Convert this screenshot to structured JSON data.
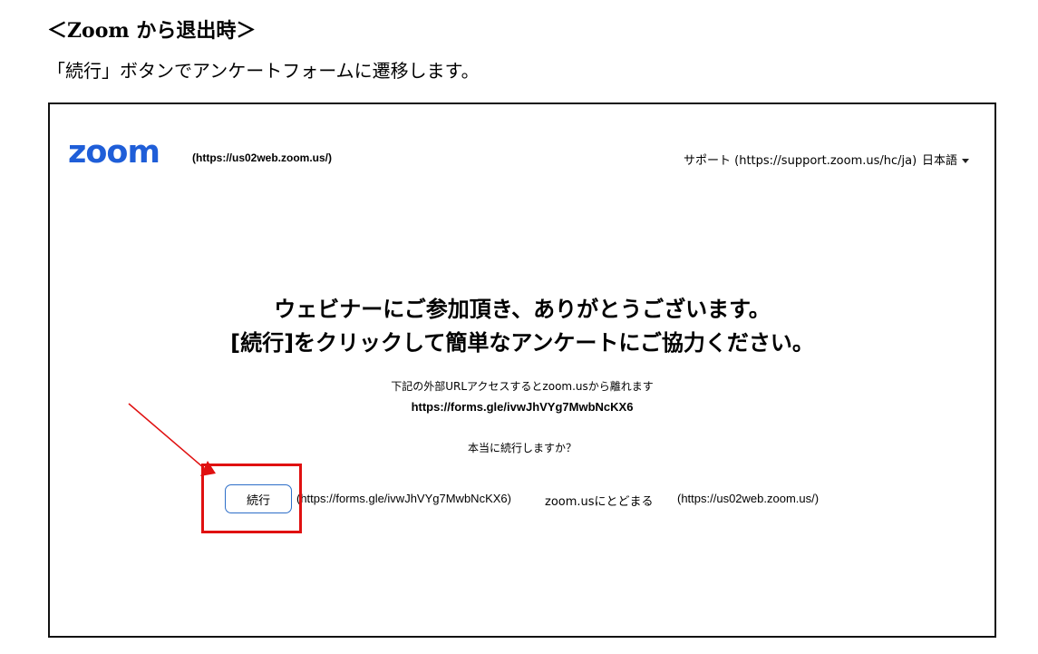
{
  "doc": {
    "heading": "＜Zoom から退出時＞",
    "subtext": "「続行」ボタンでアンケートフォームに遷移します。"
  },
  "header": {
    "logo": "zoom",
    "home_link": "(https://us02web.zoom.us/)",
    "support": "サポート (https://support.zoom.us/hc/ja)",
    "language": "日本語"
  },
  "main": {
    "headline_line1": "ウェビナーにご参加頂き、ありがとうございます。",
    "headline_line2": "[続行]をクリックして簡単なアンケートにご協力ください。",
    "notice": "下記の外部URLアクセスするとzoom.usから離れます",
    "target_url": "https://forms.gle/ivwJhVYg7MwbNcKX6",
    "confirm": "本当に続行しますか？",
    "continue_label": "続行",
    "continue_url": "(https://forms.gle/ivwJhVYg7MwbNcKX6)",
    "stay_label": "zoom.usにとどまる",
    "stay_url": "(https://us02web.zoom.us/)"
  },
  "colors": {
    "logo": "#1f5ed8",
    "button_border": "#2d6ec8",
    "annotation": "#e01010"
  },
  "icons": {
    "language_dropdown": "caret-down-icon",
    "annotation": "arrow-icon"
  }
}
